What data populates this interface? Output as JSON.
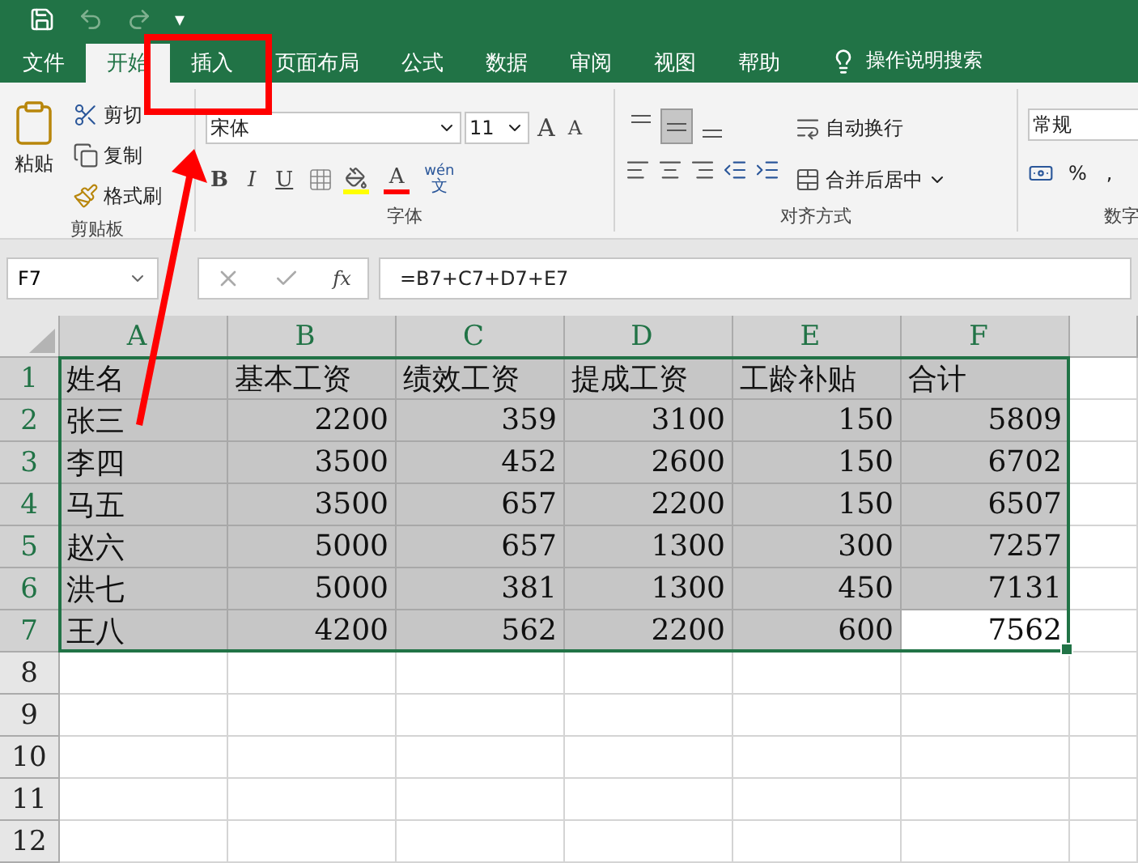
{
  "quick_access": {
    "customize": "▾"
  },
  "tabs": [
    {
      "label": "文件",
      "selected": false
    },
    {
      "label": "开始",
      "selected": true
    },
    {
      "label": "插入",
      "selected": false
    },
    {
      "label": "页面布局",
      "selected": false
    },
    {
      "label": "公式",
      "selected": false
    },
    {
      "label": "数据",
      "selected": false
    },
    {
      "label": "审阅",
      "selected": false
    },
    {
      "label": "视图",
      "selected": false
    },
    {
      "label": "帮助",
      "selected": false
    }
  ],
  "search": {
    "label": "操作说明搜索"
  },
  "clipboard": {
    "paste": "粘贴",
    "cut": "剪切",
    "copy": "复制",
    "format_painter": "格式刷",
    "group_label": "剪贴板"
  },
  "font": {
    "name": "宋体",
    "size": "11",
    "grow": "A",
    "shrink": "A",
    "bold": "B",
    "italic": "I",
    "underline": "U",
    "font_color": "A",
    "phonetic_top": "wén",
    "phonetic_bottom": "文",
    "group_label": "字体"
  },
  "alignment": {
    "vertical": [
      {
        "kind": "top",
        "selected": false
      },
      {
        "kind": "middle",
        "selected": true
      },
      {
        "kind": "bottom",
        "selected": false
      }
    ],
    "wrap_text": "自动换行",
    "merge_center": "合并后居中",
    "group_label": "对齐方式"
  },
  "number": {
    "format": "常规",
    "percent": "%",
    "comma": ",",
    "group_label": "数字"
  },
  "formula_bar": {
    "name_box": "F7",
    "fx": "fx",
    "formula": "=B7+C7+D7+E7"
  },
  "sheet": {
    "columns": [
      "A",
      "B",
      "C",
      "D",
      "E",
      "F"
    ],
    "rows": [
      {
        "number": "1",
        "selected": true,
        "cells": [
          {
            "text": "姓名",
            "active": false
          },
          {
            "text": "基本工资",
            "active": false
          },
          {
            "text": "绩效工资",
            "active": false
          },
          {
            "text": "提成工资",
            "active": false
          },
          {
            "text": "工龄补贴",
            "active": false
          },
          {
            "text": "合计",
            "active": false
          }
        ]
      },
      {
        "number": "2",
        "selected": true,
        "cells": [
          {
            "text": "张三",
            "active": false
          },
          {
            "text": "2200",
            "active": false
          },
          {
            "text": "359",
            "active": false
          },
          {
            "text": "3100",
            "active": false
          },
          {
            "text": "150",
            "active": false
          },
          {
            "text": "5809",
            "active": false
          }
        ]
      },
      {
        "number": "3",
        "selected": true,
        "cells": [
          {
            "text": "李四",
            "active": false
          },
          {
            "text": "3500",
            "active": false
          },
          {
            "text": "452",
            "active": false
          },
          {
            "text": "2600",
            "active": false
          },
          {
            "text": "150",
            "active": false
          },
          {
            "text": "6702",
            "active": false
          }
        ]
      },
      {
        "number": "4",
        "selected": true,
        "cells": [
          {
            "text": "马五",
            "active": false
          },
          {
            "text": "3500",
            "active": false
          },
          {
            "text": "657",
            "active": false
          },
          {
            "text": "2200",
            "active": false
          },
          {
            "text": "150",
            "active": false
          },
          {
            "text": "6507",
            "active": false
          }
        ]
      },
      {
        "number": "5",
        "selected": true,
        "cells": [
          {
            "text": "赵六",
            "active": false
          },
          {
            "text": "5000",
            "active": false
          },
          {
            "text": "657",
            "active": false
          },
          {
            "text": "1300",
            "active": false
          },
          {
            "text": "300",
            "active": false
          },
          {
            "text": "7257",
            "active": false
          }
        ]
      },
      {
        "number": "6",
        "selected": true,
        "cells": [
          {
            "text": "洪七",
            "active": false
          },
          {
            "text": "5000",
            "active": false
          },
          {
            "text": "381",
            "active": false
          },
          {
            "text": "1300",
            "active": false
          },
          {
            "text": "450",
            "active": false
          },
          {
            "text": "7131",
            "active": false
          }
        ]
      },
      {
        "number": "7",
        "selected": true,
        "cells": [
          {
            "text": "王八",
            "active": false
          },
          {
            "text": "4200",
            "active": false
          },
          {
            "text": "562",
            "active": false
          },
          {
            "text": "2200",
            "active": false
          },
          {
            "text": "600",
            "active": false
          },
          {
            "text": "7562",
            "active": true
          }
        ]
      },
      {
        "number": "8",
        "selected": false,
        "cells": []
      },
      {
        "number": "9",
        "selected": false,
        "cells": []
      },
      {
        "number": "10",
        "selected": false,
        "cells": []
      },
      {
        "number": "11",
        "selected": false,
        "cells": []
      },
      {
        "number": "12",
        "selected": false,
        "cells": []
      }
    ]
  }
}
